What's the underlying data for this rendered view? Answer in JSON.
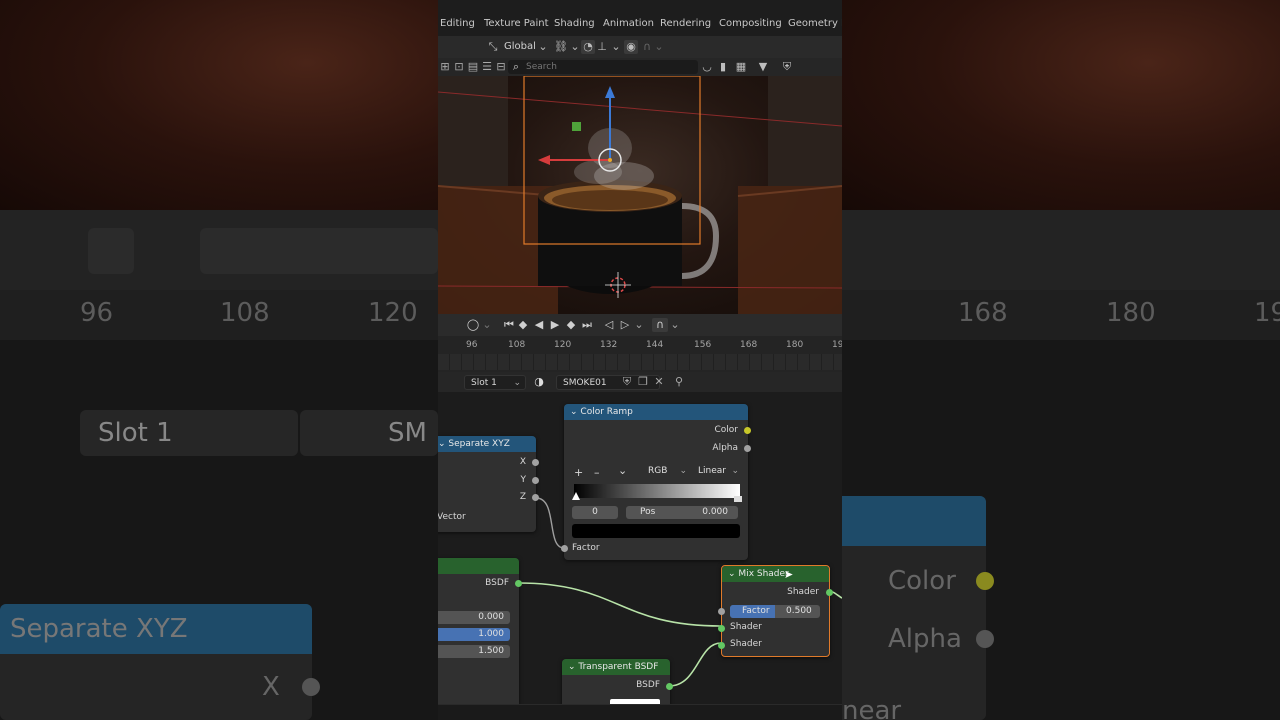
{
  "workspace_tabs": [
    "Editing",
    "Texture Paint",
    "Shading",
    "Animation",
    "Rendering",
    "Compositing",
    "Geometry No"
  ],
  "viewport_header": {
    "orientation": "Global"
  },
  "search": {
    "placeholder": "Search"
  },
  "timeline": {
    "frame_ticks": [
      "96",
      "108",
      "120",
      "132",
      "144",
      "156",
      "168",
      "180",
      "19"
    ]
  },
  "background_ruler_ticks": [
    "96",
    "108",
    "120",
    "168",
    "180",
    "19"
  ],
  "node_header": {
    "slot": "Slot 1",
    "material": "SMOKE01"
  },
  "background_overlay": {
    "slot": "Slot 1",
    "material_partial": "SM",
    "node_title": "Separate XYZ",
    "x_label": "X",
    "color_label": "Color",
    "alpha_label": "Alpha",
    "interp_partial": "near"
  },
  "nodes": {
    "color_ramp": {
      "title": "Color Ramp",
      "out_color": "Color",
      "out_alpha": "Alpha",
      "add_btn": "+",
      "remove_btn": "–",
      "more_btn": "⌄",
      "color_mode": "RGB",
      "interpolation": "Linear",
      "stop_index": "0",
      "pos_label": "Pos",
      "pos_value": "0.000",
      "in_factor": "Factor"
    },
    "separate_xyz": {
      "title": "Separate XYZ",
      "out_x": "X",
      "out_y": "Y",
      "out_z": "Z",
      "in_vector": "Vector"
    },
    "principled": {
      "out_bsdf": "BSDF",
      "val1": "0.000",
      "val2": "1.000",
      "val3": "1.500"
    },
    "mix_shader": {
      "title": "Mix Shader",
      "out_shader": "Shader",
      "factor_label": "Factor",
      "factor_value": "0.500",
      "in_shader1": "Shader",
      "in_shader2": "Shader"
    },
    "transparent_bsdf": {
      "title": "Transparent BSDF",
      "out_bsdf": "BSDF"
    }
  },
  "colors": {
    "node_header_blue": "#23557a",
    "node_header_green": "#28622d",
    "shader_socket": "#63c763",
    "color_socket": "#c7c729",
    "float_socket": "#a1a1a1",
    "link_shader": "#b8e3a8",
    "selected_outline": "#e07a2a",
    "factor_highlight": "#4772b3"
  }
}
